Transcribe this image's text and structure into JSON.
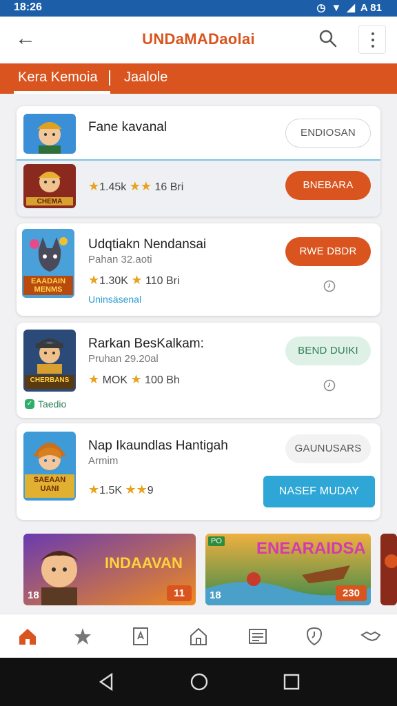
{
  "status_bar": {
    "time": "18:26",
    "right_text": "A 81"
  },
  "app_bar": {
    "title": "UNDaMADaolai"
  },
  "tabs": [
    {
      "label": "Kera Kemoia"
    },
    {
      "label": "Jaalole"
    }
  ],
  "colors": {
    "accent": "#d9541e",
    "status_bar": "#1c5fa8",
    "blue_button": "#2ea7d6"
  },
  "card1": {
    "name": "Fane kavanal",
    "rating": "1.45k",
    "rating2": "16 Bri",
    "button_top": "ENDIOSAN",
    "button_bottom": "BNEBARA",
    "thumb_caption": "CHEMA"
  },
  "card2": {
    "name": "Udqtiakn Nendansai",
    "sub": "Pahan  32.aoti",
    "rating": "1.30K",
    "rating2": "110 Bri",
    "tagline": "Uninsäsenal",
    "button": "RWE DBDR",
    "thumb_caption": "EAADAIN\nMENMS"
  },
  "card3": {
    "name": "Rarkan BesKalkam:",
    "sub": "Pruhan  29.20al",
    "rating": "MOK",
    "rating2": "100 Bh",
    "badge": "Taedio",
    "button": "BEND DUIKI",
    "thumb_caption": "CHERBANS"
  },
  "card4": {
    "name": "Nap Ikaundlas Hantigah",
    "sub": "Armim",
    "rating": "1.5K",
    "rating2": "9",
    "button_outline": "GAUNUSARS",
    "button_primary": "NASEF MUDAY",
    "thumb_caption": "SAEAAN\nUANI"
  },
  "banners": [
    {
      "title": "INDAAVAN",
      "left_num": "18",
      "right_num": "11"
    },
    {
      "title": "ENEARAIDSA",
      "chip": "PO",
      "left_num": "18",
      "right_num": "230"
    }
  ],
  "bottom_nav": [
    {
      "icon": "home-icon"
    },
    {
      "icon": "star-icon"
    },
    {
      "icon": "bookmark-icon"
    },
    {
      "icon": "store-icon"
    },
    {
      "icon": "list-icon"
    },
    {
      "icon": "clock-icon"
    },
    {
      "icon": "handshake-icon"
    }
  ]
}
